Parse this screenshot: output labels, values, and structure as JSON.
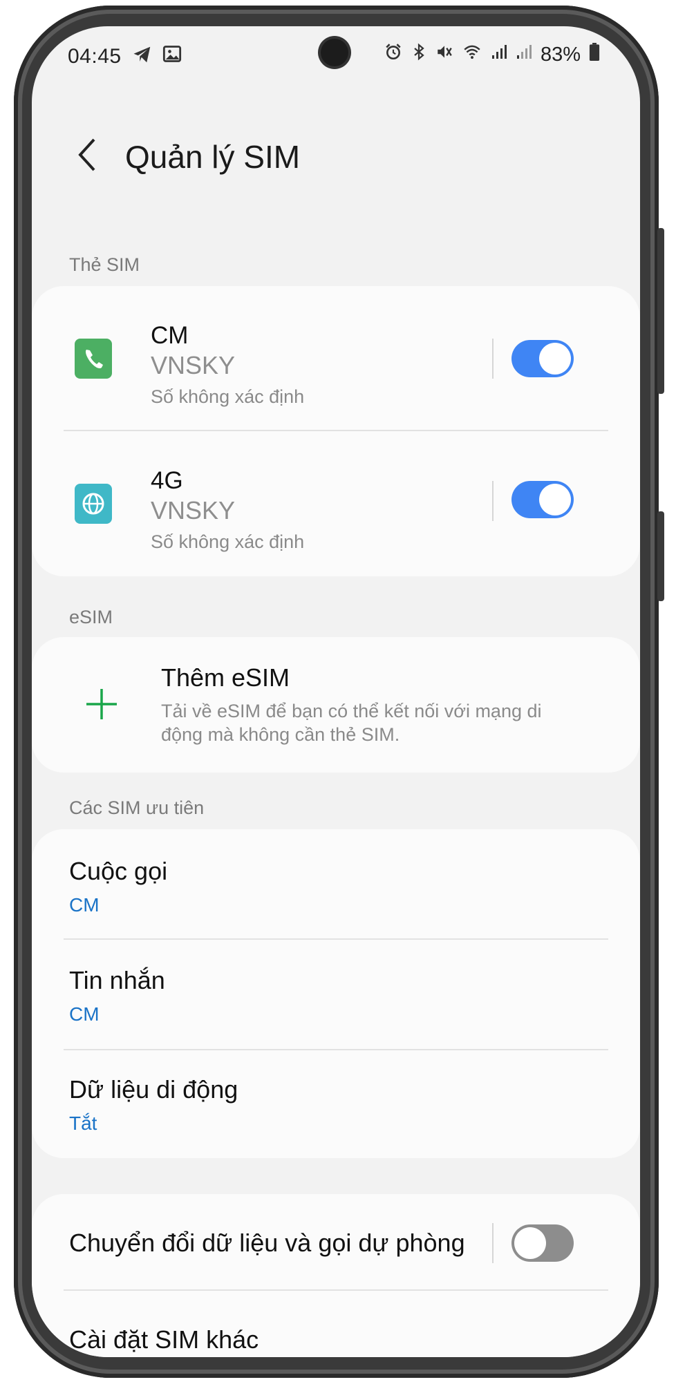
{
  "status": {
    "time": "04:45",
    "battery_pct": "83%",
    "left_icons": [
      "telegram-icon",
      "gallery-icon"
    ],
    "right_icons": [
      "alarm-icon",
      "bluetooth-icon",
      "mute-icon",
      "wifi-icon",
      "signal-icon",
      "signal-icon"
    ]
  },
  "header": {
    "title": "Quản lý SIM"
  },
  "sim_cards": {
    "label": "Thẻ SIM",
    "items": [
      {
        "name": "CM",
        "carrier": "VNSKY",
        "number": "Số không xác định",
        "icon": "phone-sim-icon",
        "color": "#4caf63",
        "enabled": true
      },
      {
        "name": "4G",
        "carrier": "VNSKY",
        "number": "Số không xác định",
        "icon": "globe-sim-icon",
        "color": "#3fb8c7",
        "enabled": true
      }
    ]
  },
  "esim": {
    "label": "eSIM",
    "add_title": "Thêm eSIM",
    "add_desc_line1": "Tải về eSIM để bạn có thể kết nối với mạng di",
    "add_desc_line2": "động mà không cần thẻ SIM.",
    "accent": "#1aa64a"
  },
  "preferred": {
    "label": "Các SIM ưu tiên",
    "items": [
      {
        "title": "Cuộc gọi",
        "value": "CM"
      },
      {
        "title": "Tin nhắn",
        "value": "CM"
      },
      {
        "title": "Dữ liệu di động",
        "value": "Tắt"
      }
    ]
  },
  "other": {
    "fallback_label": "Chuyển đổi dữ liệu và gọi dự phòng",
    "fallback_enabled": false,
    "more_settings_label": "Cài đặt SIM khác"
  },
  "colors": {
    "toggle_on": "#3f85f4",
    "link_blue": "#1a73c7"
  }
}
